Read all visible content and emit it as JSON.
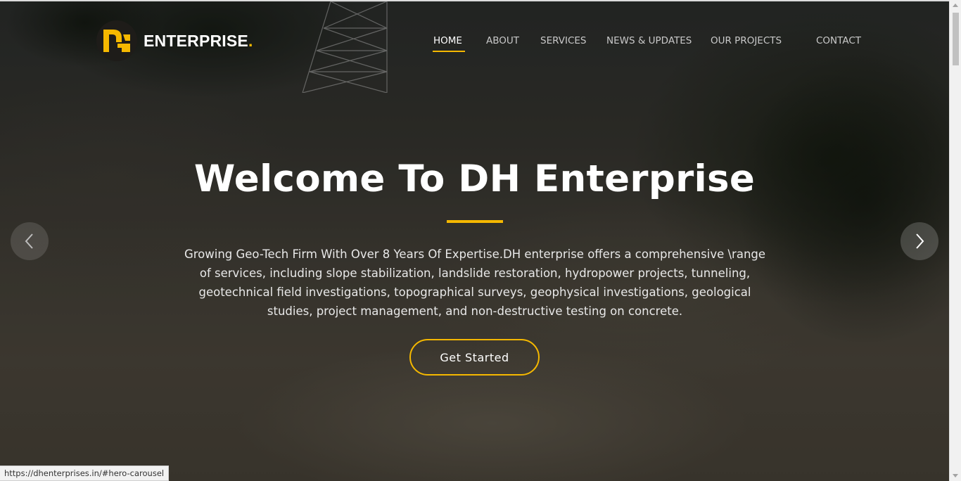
{
  "brand": {
    "logo_text": "ENTERPRISE",
    "logo_dot": ".",
    "accent_color": "#f5b800"
  },
  "nav": {
    "items": [
      {
        "label": "HOME",
        "active": true
      },
      {
        "label": "ABOUT",
        "active": false
      },
      {
        "label": "SERVICES",
        "active": false
      },
      {
        "label": "NEWS & UPDATES",
        "active": false
      },
      {
        "label": "OUR PROJECTS",
        "active": false
      },
      {
        "label": "CONTACT",
        "active": false
      }
    ]
  },
  "hero": {
    "title": "Welcome To DH Enterprise",
    "description": "Growing Geo-Tech Firm With Over 8 Years Of Expertise.DH enterprise offers a comprehensive \\range of services, including slope stabilization, landslide restoration, hydropower projects, tunneling, geotechnical field investigations, topographical surveys, geophysical investigations, geological studies, project management, and non-destructive testing on concrete.",
    "cta_label": "Get Started",
    "prev_icon": "chevron-left-icon",
    "next_icon": "chevron-right-icon"
  },
  "status_bar": {
    "url": "https://dhenterprises.in/#hero-carousel"
  }
}
